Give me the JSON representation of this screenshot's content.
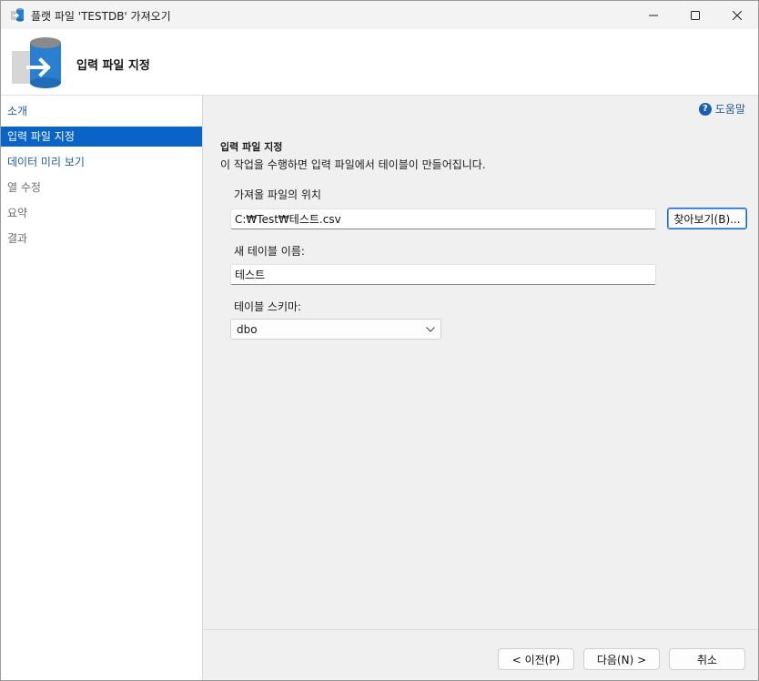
{
  "window": {
    "title": "플랫 파일 'TESTDB' 가져오기"
  },
  "header": {
    "title": "입력 파일 지정"
  },
  "nav": {
    "items": [
      {
        "label": "소개"
      },
      {
        "label": "입력 파일 지정"
      },
      {
        "label": "데이터 미리 보기"
      },
      {
        "label": "열 수정"
      },
      {
        "label": "요약"
      },
      {
        "label": "결과"
      }
    ]
  },
  "help": {
    "label": "도움말"
  },
  "section": {
    "title": "입력 파일 지정",
    "description": "이 작업을 수행하면 입력 파일에서 테이블이 만들어집니다."
  },
  "file_location": {
    "label": "가져올 파일의 위치",
    "value": "C:₩Test₩테스트.csv",
    "browse_label": "찾아보기(B)..."
  },
  "table_name": {
    "label": "새 테이블 이름:",
    "value": "테스트"
  },
  "schema": {
    "label": "테이블 스키마:",
    "selected": "dbo"
  },
  "footer": {
    "prev_label": "< 이전(P)",
    "next_label": "다음(N) >",
    "cancel_label": "취소"
  },
  "colors": {
    "accent": "#0a64c8",
    "link": "#1e5aa8",
    "icon_blue": "#2b7fd0"
  }
}
